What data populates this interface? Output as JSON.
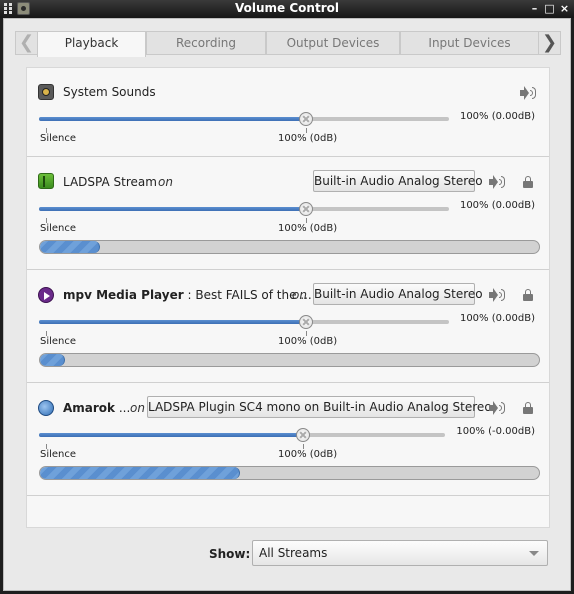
{
  "window": {
    "title": "Volume Control",
    "controls": {
      "minimize": "–",
      "maximize": "□",
      "close": "×"
    }
  },
  "tabs": [
    {
      "label": "Playback",
      "active": true
    },
    {
      "label": "Recording",
      "active": false
    },
    {
      "label": "Output Devices",
      "active": false
    },
    {
      "label": "Input Devices",
      "active": false
    }
  ],
  "tab_arrows": {
    "left": "❮",
    "right": "❯"
  },
  "slider_labels": {
    "silence": "Silence",
    "unity": "100% (0dB)"
  },
  "streams": [
    {
      "name": "System Sounds",
      "icon": "speaker-icon",
      "volume_text": "100% (0.00dB)",
      "volume_fraction": 0.65
    },
    {
      "name": "LADSPA Stream",
      "on": "on",
      "device": "Built-in Audio Analog Stereo",
      "icon": "ladspa-app-icon",
      "volume_text": "100% (0.00dB)",
      "volume_fraction": 0.65,
      "peak_fraction": 0.12
    },
    {
      "name_bold": "mpv Media Player",
      "name_rest": " : Best FAILS of the ...",
      "on": "on",
      "device": "Built-in Audio Analog Stereo",
      "icon": "mpv-icon",
      "volume_text": "100% (0.00dB)",
      "volume_fraction": 0.65,
      "peak_fraction": 0.05
    },
    {
      "name_bold": "Amarok",
      "name_rest": " ...",
      "on": "on",
      "device": "LADSPA Plugin SC4 mono on Built-in Audio Analog Stereo",
      "icon": "amarok-icon",
      "volume_text": "100% (-0.00dB)",
      "volume_fraction": 0.65,
      "peak_fraction": 0.4
    }
  ],
  "footer": {
    "show_label": "Show:",
    "show_value": "All Streams"
  },
  "colors": {
    "accent": "#4a7fc3",
    "background": "#e9e9e9",
    "panel": "#f7f7f7"
  }
}
